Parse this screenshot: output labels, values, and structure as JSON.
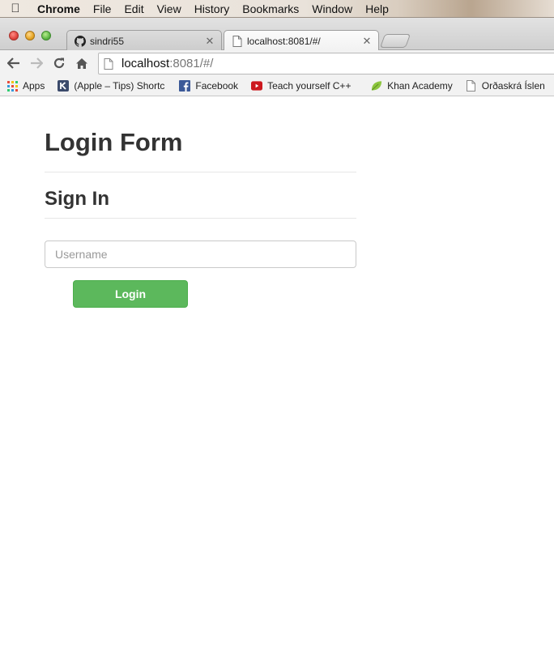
{
  "menubar": {
    "app_name": "Chrome",
    "items": [
      "File",
      "Edit",
      "View",
      "History",
      "Bookmarks",
      "Window",
      "Help"
    ]
  },
  "tabs": [
    {
      "title": "sindri55",
      "icon": "github-icon",
      "active": false
    },
    {
      "title": "localhost:8081/#/",
      "icon": "page-icon",
      "active": true
    }
  ],
  "toolbar": {
    "url_host": "localhost",
    "url_rest": ":8081/#/"
  },
  "bookmarks": [
    {
      "label": "Apps",
      "icon": "apps-grid-icon"
    },
    {
      "label": "(Apple – Tips) Shortc",
      "icon": "k-icon"
    },
    {
      "label": "Facebook",
      "icon": "facebook-icon"
    },
    {
      "label": "Teach yourself C++",
      "icon": "youtube-icon"
    },
    {
      "label": "Khan Academy",
      "icon": "leaf-icon"
    },
    {
      "label": "Orðaskrá Íslen",
      "icon": "page-icon"
    }
  ],
  "page": {
    "title": "Login Form",
    "subtitle": "Sign In",
    "username_placeholder": "Username",
    "username_value": "",
    "login_label": "Login"
  },
  "colors": {
    "login_button": "#5cb85c",
    "heading_text": "#333333"
  }
}
